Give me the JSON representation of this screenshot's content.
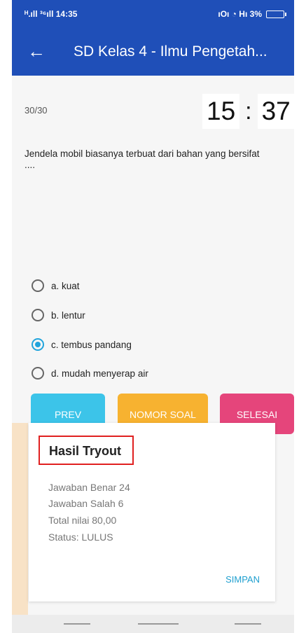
{
  "status_bar": {
    "left": "ᴴ.ıll ³⁶ıll 14:35",
    "right": "ıOı ◔ Hı 3%"
  },
  "appbar": {
    "title": "SD Kelas 4 - Ilmu Pengetah..."
  },
  "quiz": {
    "counter": "30/30",
    "timer_min": "15",
    "timer_sep": ":",
    "timer_sec": "37",
    "question": "Jendela mobil biasanya terbuat dari bahan yang bersifat ....",
    "options": [
      {
        "label": "a. kuat",
        "checked": false
      },
      {
        "label": "b. lentur",
        "checked": false
      },
      {
        "label": "c. tembus pandang",
        "checked": true
      },
      {
        "label": "d. mudah menyerap air",
        "checked": false
      }
    ]
  },
  "buttons": {
    "prev": "PREV",
    "nomor": "NOMOR SOAL",
    "selesai": "SELESAI"
  },
  "dialog": {
    "title": "Hasil Tryout",
    "lines": [
      "Jawaban Benar 24",
      "Jawaban Salah 6",
      "Total nilai 80,00",
      "Status: LULUS"
    ],
    "action": "SIMPAN"
  },
  "colors": {
    "primary": "#1f4fb8",
    "accent": "#21a4dc",
    "prev": "#3cc4e9",
    "nomor": "#f7b230",
    "selesai": "#e5457b"
  }
}
